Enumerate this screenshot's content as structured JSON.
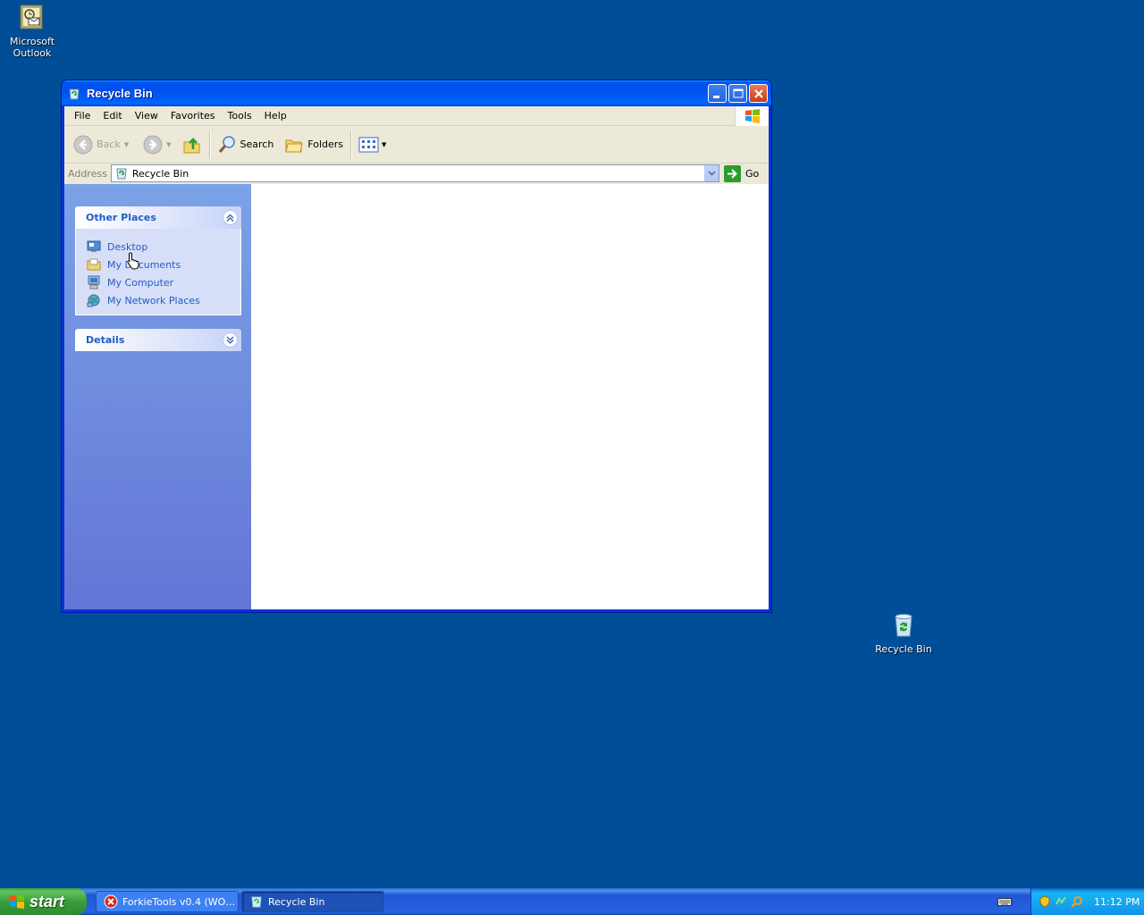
{
  "desktop": {
    "icons": [
      {
        "label_line1": "Microsoft",
        "label_line2": "Outlook",
        "icon": "outlook-icon"
      },
      {
        "label": "Recycle Bin",
        "icon": "recycle-bin-icon"
      }
    ]
  },
  "window": {
    "title": "Recycle Bin",
    "menu": [
      "File",
      "Edit",
      "View",
      "Favorites",
      "Tools",
      "Help"
    ],
    "toolbar": {
      "back": "Back",
      "search": "Search",
      "folders": "Folders"
    },
    "address": {
      "label": "Address",
      "value": "Recycle Bin",
      "go": "Go"
    },
    "taskpane": {
      "other_places": {
        "title": "Other Places",
        "items": [
          "Desktop",
          "My Documents",
          "My Computer",
          "My Network Places"
        ]
      },
      "details": {
        "title": "Details"
      }
    }
  },
  "taskbar": {
    "start": "start",
    "items": [
      {
        "label": "ForkieTools v0.4 (WO…",
        "icon": "error-icon"
      },
      {
        "label": "Recycle Bin",
        "icon": "recycle-bin-icon"
      }
    ],
    "clock": "11:12 PM"
  },
  "colors": {
    "desktop": "#004e98",
    "link": "#215dc6",
    "titlebar": "#0053ee"
  }
}
